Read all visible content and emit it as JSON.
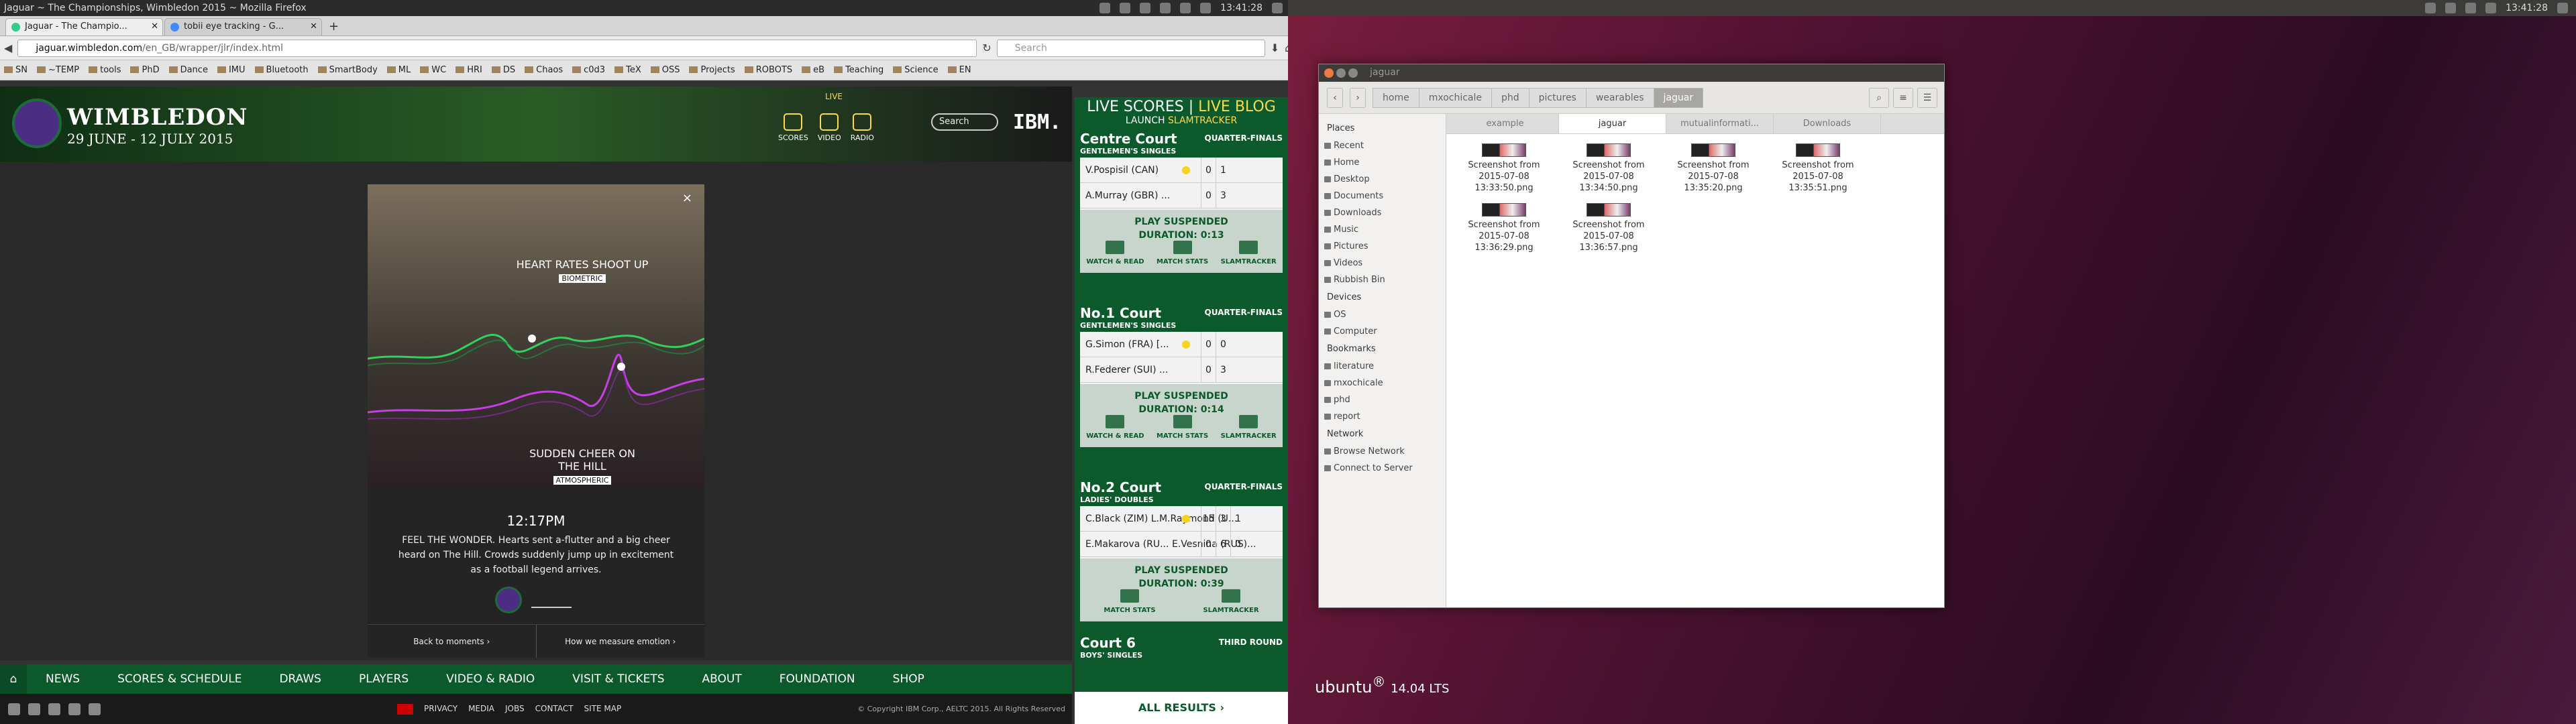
{
  "left": {
    "window_title": "Jaguar ~ The Championships, Wimbledon 2015 ~ Mozilla Firefox",
    "clock": "13:41:28",
    "tabs": [
      {
        "label": "Jaguar - The Champio..."
      },
      {
        "label": "tobii eye tracking - G..."
      }
    ],
    "url_host": "jaguar.wimbledon.com",
    "url_path": "/en_GB/wrapper/jlr/index.html",
    "search_placeholder": "Search",
    "bookmarks": [
      "SN",
      "~TEMP",
      "tools",
      "PhD",
      "Dance",
      "IMU",
      "Bluetooth",
      "SmartBody",
      "ML",
      "WC",
      "HRI",
      "DS",
      "Chaos",
      "c0d3",
      "TeX",
      "OSS",
      "Projects",
      "ROBOTS",
      "eB",
      "Teaching",
      "Science",
      "EN"
    ]
  },
  "wimbledon": {
    "name": "WIMBLEDON",
    "dates": "29 JUNE - 12 JULY 2015",
    "live": "LIVE",
    "header_icons": [
      "SCORES",
      "VIDEO",
      "RADIO"
    ],
    "search": "Search",
    "ibm": "IBM.",
    "modal": {
      "close": "×",
      "heart_title": "HEART RATES SHOOT UP",
      "heart_tag": "BIOMETRIC",
      "cheer_title": "SUDDEN CHEER ON THE HILL",
      "cheer_tag": "ATMOSPHERIC",
      "time": "12:17PM",
      "desc": "FEEL THE WONDER. Hearts sent a-flutter and a big cheer heard on The Hill. Crowds suddenly jump up in excitement as a football legend arrives.",
      "back": "Back to moments ›",
      "how": "How we measure emotion ›"
    },
    "live_panel": {
      "title_a": "LIVE SCORES",
      "title_sep": " | ",
      "title_b": "LIVE BLOG",
      "launch": "LAUNCH",
      "slam": "SLAMTRACKER",
      "courts": [
        {
          "name": "Centre Court",
          "round": "QUARTER-FINALS",
          "event": "GENTLEMEN'S SINGLES",
          "p1": "V.Pospisil (CAN)",
          "p1_sets": [
            "0",
            "1"
          ],
          "p2": "A.Murray (GBR) ...",
          "p2_sets": [
            "0",
            "3"
          ],
          "status": "PLAY SUSPENDED",
          "duration": "DURATION: 0:13",
          "actions": [
            "WATCH & READ",
            "MATCH STATS",
            "SLAMTRACKER"
          ]
        },
        {
          "name": "No.1 Court",
          "round": "QUARTER-FINALS",
          "event": "GENTLEMEN'S SINGLES",
          "p1": "G.Simon (FRA) [...",
          "p1_sets": [
            "0",
            "0"
          ],
          "p2": "R.Federer (SUI) ...",
          "p2_sets": [
            "0",
            "3"
          ],
          "status": "PLAY SUSPENDED",
          "duration": "DURATION: 0:14",
          "actions": [
            "WATCH & READ",
            "MATCH STATS",
            "SLAMTRACKER"
          ]
        },
        {
          "name": "No.2 Court",
          "round": "QUARTER-FINALS",
          "event": "LADIES' DOUBLES",
          "p1": "C.Black (ZIM) L.M.Raymond (U...",
          "p1_sets": [
            "15",
            "3",
            "1"
          ],
          "p2": "E.Makarova (RU... E.Vesnina (RUS)...",
          "p2_sets": [
            "0",
            "6",
            "0"
          ],
          "status": "PLAY SUSPENDED",
          "duration": "DURATION: 0:39",
          "actions": [
            "MATCH STATS",
            "SLAMTRACKER"
          ]
        }
      ],
      "court6": "Court 6",
      "court6_round": "THIRD ROUND",
      "court6_event": "BOYS' SINGLES",
      "all_results": "ALL RESULTS ›"
    },
    "nav": [
      "NEWS",
      "SCORES & SCHEDULE",
      "DRAWS",
      "PLAYERS",
      "VIDEO & RADIO",
      "VISIT & TICKETS",
      "ABOUT",
      "FOUNDATION",
      "SHOP"
    ],
    "footer_links": [
      "PRIVACY",
      "MEDIA",
      "JOBS",
      "CONTACT",
      "SITE MAP"
    ],
    "copyright": "© Copyright IBM Corp., AELTC 2015. All Rights Reserved"
  },
  "right": {
    "clock": "13:41:28",
    "brand": "ubuntu",
    "version": "14.04 LTS",
    "nautilus": {
      "title": "jaguar",
      "breadcrumb": [
        "home",
        "mxochicale",
        "phd",
        "pictures",
        "wearables",
        "jaguar"
      ],
      "tabs": [
        "example",
        "jaguar",
        "mutualinformati...",
        "Downloads"
      ],
      "places_h": "Places",
      "places": [
        "Recent",
        "Home",
        "Desktop",
        "Documents",
        "Downloads",
        "Music",
        "Pictures",
        "Videos",
        "Rubbish Bin"
      ],
      "devices_h": "Devices",
      "devices": [
        "OS",
        "Computer"
      ],
      "bookmarks_h": "Bookmarks",
      "bookmarks": [
        "literature",
        "mxochicale",
        "phd",
        "report"
      ],
      "network_h": "Network",
      "network": [
        "Browse Network",
        "Connect to Server"
      ],
      "files": [
        [
          "Screenshot from",
          "2015-07-08",
          "13:33:50.png"
        ],
        [
          "Screenshot from",
          "2015-07-08",
          "13:34:50.png"
        ],
        [
          "Screenshot from",
          "2015-07-08",
          "13:35:20.png"
        ],
        [
          "Screenshot from",
          "2015-07-08",
          "13:35:51.png"
        ],
        [
          "Screenshot from",
          "2015-07-08",
          "13:36:29.png"
        ],
        [
          "Screenshot from",
          "2015-07-08",
          "13:36:57.png"
        ]
      ]
    }
  }
}
